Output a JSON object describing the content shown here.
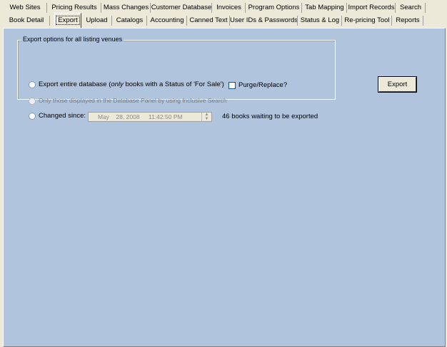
{
  "tabs_row1": [
    "Web Sites",
    "Pricing Results",
    "Mass Changes",
    "Customer Database",
    "Invoices",
    "Program Options",
    "Tab Mapping",
    "Import Records",
    "Search"
  ],
  "tabs_row2": [
    "Book Detail",
    "Export",
    "Upload",
    "Catalogs",
    "Accounting",
    "Canned Text",
    "User IDs & Passwords",
    "Status & Log",
    "Re-pricing Tool",
    "Reports"
  ],
  "active_tab": "Export",
  "export_group": {
    "legend": "Export options for all listing venues",
    "option_entire_prefix": "Export entire database (",
    "option_entire_emph": "only",
    "option_entire_suffix": " books with a Status of 'For Sale')",
    "option_displayed": "Only those displayed in the Database Panel by using Inclusive Search",
    "option_changed": "Changed since:",
    "changed_date": "May    28, 2008",
    "changed_time": "11:42:50 PM",
    "waiting_text": "46 books waiting to be exported",
    "purge_label": "Purge/Replace?",
    "purge_checked": false
  },
  "export_button_label": "Export"
}
